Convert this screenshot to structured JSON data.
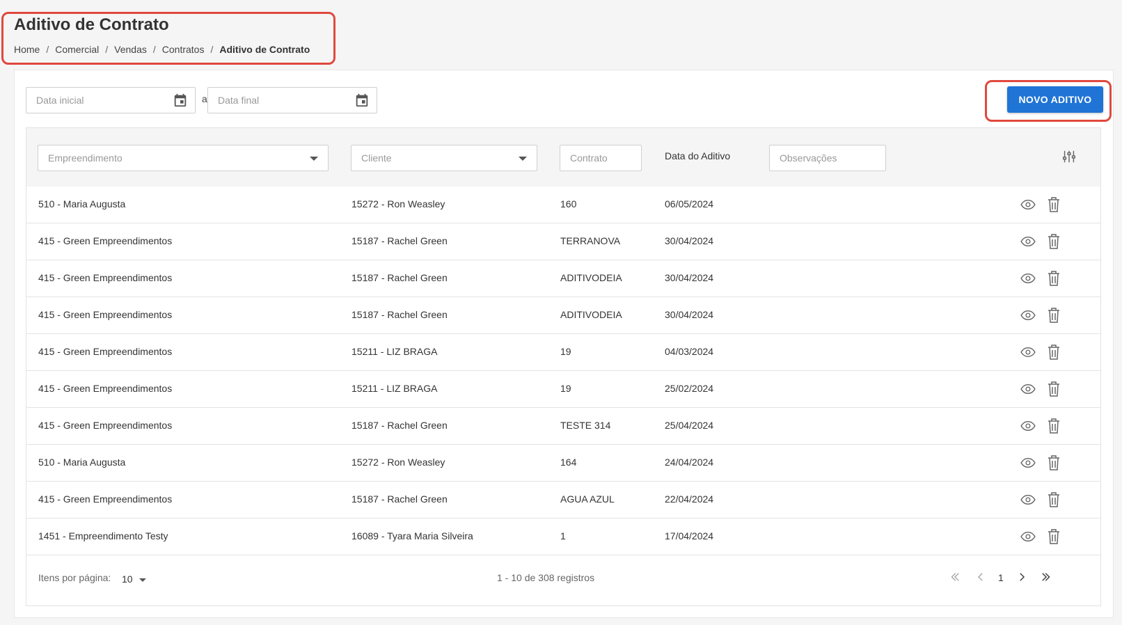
{
  "page": {
    "title": "Aditivo de Contrato",
    "breadcrumb": [
      "Home",
      "Comercial",
      "Vendas",
      "Contratos",
      "Aditivo de Contrato"
    ]
  },
  "toolbar": {
    "date_start_placeholder": "Data inicial",
    "date_separator": "a",
    "date_end_placeholder": "Data final",
    "new_button_label": "NOVO ADITIVO",
    "accent_color": "#1f74d6",
    "highlight_color": "#e0483e"
  },
  "filters": {
    "empreendimento_placeholder": "Empreendimento",
    "cliente_placeholder": "Cliente",
    "contrato_placeholder": "Contrato",
    "data_aditivo_header": "Data do Aditivo",
    "observacoes_placeholder": "Observações"
  },
  "rows": [
    {
      "empreendimento": "510 - Maria Augusta",
      "cliente": "15272 - Ron Weasley",
      "contrato": "160",
      "data": "06/05/2024"
    },
    {
      "empreendimento": "415 - Green Empreendimentos",
      "cliente": "15187 - Rachel Green",
      "contrato": "TERRANOVA",
      "data": "30/04/2024"
    },
    {
      "empreendimento": "415 - Green Empreendimentos",
      "cliente": "15187 - Rachel Green",
      "contrato": "ADITIVODEIA",
      "data": "30/04/2024"
    },
    {
      "empreendimento": "415 - Green Empreendimentos",
      "cliente": "15187 - Rachel Green",
      "contrato": "ADITIVODEIA",
      "data": "30/04/2024"
    },
    {
      "empreendimento": "415 - Green Empreendimentos",
      "cliente": "15211 - LIZ BRAGA",
      "contrato": "19",
      "data": "04/03/2024"
    },
    {
      "empreendimento": "415 - Green Empreendimentos",
      "cliente": "15211 - LIZ BRAGA",
      "contrato": "19",
      "data": "25/02/2024"
    },
    {
      "empreendimento": "415 - Green Empreendimentos",
      "cliente": "15187 - Rachel Green",
      "contrato": "TESTE 314",
      "data": "25/04/2024"
    },
    {
      "empreendimento": "510 - Maria Augusta",
      "cliente": "15272 - Ron Weasley",
      "contrato": "164",
      "data": "24/04/2024"
    },
    {
      "empreendimento": "415 - Green Empreendimentos",
      "cliente": "15187 - Rachel Green",
      "contrato": "AGUA AZUL",
      "data": "22/04/2024"
    },
    {
      "empreendimento": "1451 - Empreendimento Testy",
      "cliente": "16089 - Tyara Maria Silveira",
      "contrato": "1",
      "data": "17/04/2024"
    }
  ],
  "row_actions": [
    "eye-icon",
    "trash-icon"
  ],
  "pagination": {
    "items_per_page_label": "Itens por página:",
    "items_per_page_value": "10",
    "records_text": "1 - 10 de 308 registros",
    "current_page": "1"
  }
}
